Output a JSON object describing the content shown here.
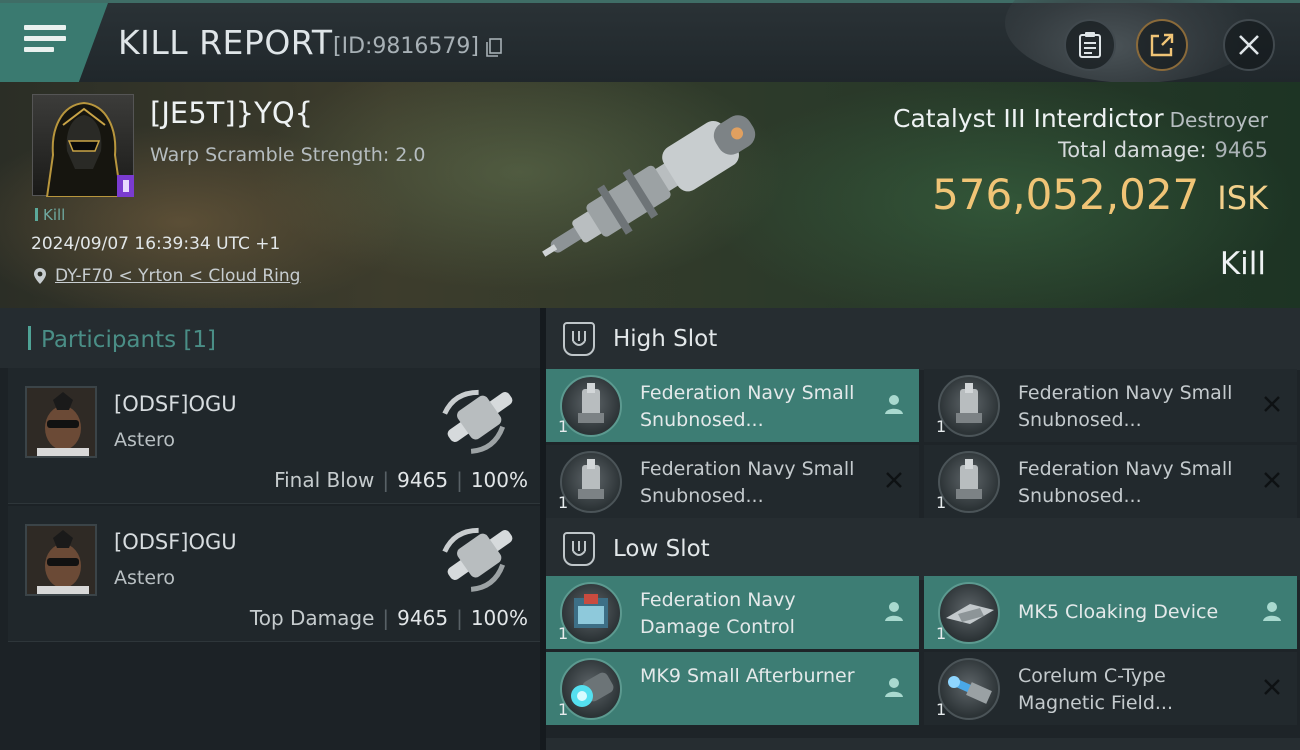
{
  "header": {
    "title": "KILL REPORT",
    "report_id": "[ID:9816579]"
  },
  "victim": {
    "pilot_name": "[JE5T]}YQ{",
    "warp_scramble": "Warp Scramble Strength: 2.0",
    "kill_tag": "Kill",
    "timestamp": "2024/09/07 16:39:34 UTC +1",
    "location": "DY-F70 < Yrton < Cloud Ring",
    "ship_name": "Catalyst III Interdictor",
    "ship_class": "Destroyer",
    "total_damage_label": "Total damage:",
    "total_damage_value": "9465",
    "isk_value": "576,052,027",
    "isk_unit": "ISK",
    "result": "Kill"
  },
  "participants": {
    "header": "Participants [1]",
    "items": [
      {
        "name": "[ODSF]OGU",
        "ship": "Astero",
        "role": "Final Blow",
        "damage": "9465",
        "percent": "100%"
      },
      {
        "name": "[ODSF]OGU",
        "ship": "Astero",
        "role": "Top Damage",
        "damage": "9465",
        "percent": "100%"
      }
    ]
  },
  "fitting": {
    "high_slot": {
      "title": "High Slot",
      "modules": [
        {
          "name": "Federation Navy Small Snubnosed...",
          "qty": "1",
          "status": "fitted"
        },
        {
          "name": "Federation Navy Small Snubnosed...",
          "qty": "1",
          "status": "destroyed"
        },
        {
          "name": "Federation Navy Small Snubnosed...",
          "qty": "1",
          "status": "destroyed"
        },
        {
          "name": "Federation Navy Small Snubnosed...",
          "qty": "1",
          "status": "destroyed"
        }
      ]
    },
    "low_slot": {
      "title": "Low Slot",
      "modules": [
        {
          "name": "Federation Navy Damage Control",
          "qty": "1",
          "status": "fitted"
        },
        {
          "name": "MK5 Cloaking Device",
          "qty": "1",
          "status": "fitted"
        },
        {
          "name": "MK9 Small Afterburner",
          "qty": "1",
          "status": "fitted"
        },
        {
          "name": "Corelum C-Type Magnetic Field...",
          "qty": "1",
          "status": "destroyed"
        }
      ]
    }
  },
  "colors": {
    "accent": "#3d7d74",
    "isk": "#f0c476",
    "panel": "#22292d"
  },
  "icons": [
    "menu-icon",
    "copy-icon",
    "clipboard-icon",
    "share-icon",
    "close-icon",
    "location-pin-icon",
    "high-slot-icon",
    "low-slot-icon",
    "dropped-icon",
    "destroyed-icon"
  ]
}
